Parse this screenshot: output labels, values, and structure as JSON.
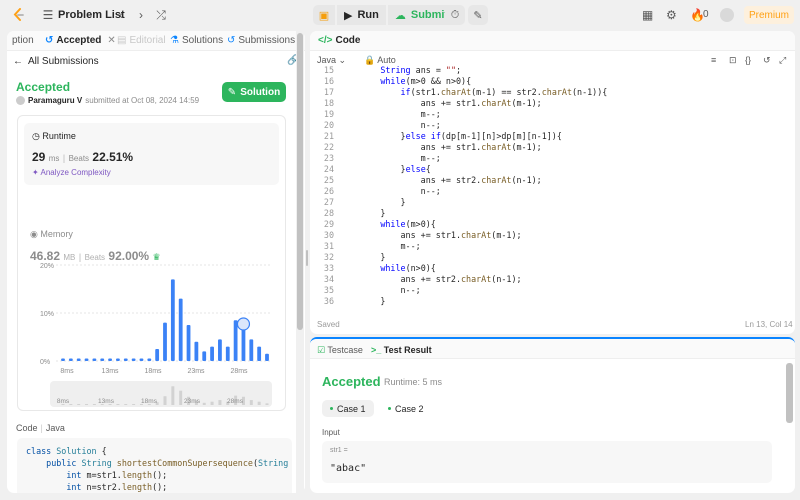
{
  "topbar": {
    "problem_list_label": "Problem List",
    "run_label": "Run",
    "submit_label": "Submit",
    "streak_count": "0",
    "premium_label": "Premium"
  },
  "left_tabs": [
    {
      "label": "ption"
    },
    {
      "label": "Accepted"
    },
    {
      "label": "Editorial"
    },
    {
      "label": "Solutions"
    },
    {
      "label": "Submissions"
    }
  ],
  "submission": {
    "back_label": "All Submissions",
    "status": "Accepted",
    "user": "Paramaguru V",
    "submitted_text": "submitted at Oct 08, 2024 14:59",
    "solution_button": "Solution"
  },
  "runtime": {
    "label": "Runtime",
    "value": "29",
    "unit": "ms",
    "beats_label": "Beats",
    "beats_value": "22.51%",
    "analyze_label": "Analyze Complexity"
  },
  "memory": {
    "label": "Memory",
    "value": "46.82",
    "unit": "MB",
    "beats_label": "Beats",
    "beats_value": "92.00%"
  },
  "chart_data": {
    "type": "bar",
    "y_ticks": [
      "20%",
      "10%",
      "0%"
    ],
    "ylim": [
      0,
      20
    ],
    "x_ticks": [
      "8ms",
      "13ms",
      "18ms",
      "23ms",
      "28ms"
    ],
    "values": [
      0.5,
      0.5,
      0.5,
      0.5,
      0.5,
      0.5,
      0.5,
      0.5,
      0.5,
      0.5,
      0.5,
      0.5,
      2.5,
      8,
      17,
      13,
      7.5,
      4,
      2,
      3,
      4.5,
      3,
      8.5,
      7.5,
      4.5,
      3,
      1.5
    ],
    "highlight_index": 23,
    "mini_x_ticks": [
      "8ms",
      "13ms",
      "18ms",
      "23ms",
      "28ms"
    ]
  },
  "code_section": {
    "label": "Code",
    "language": "Java",
    "lines": [
      "class Solution {",
      "    public String shortestCommonSupersequence(String",
      "        int m=str1.length();",
      "        int n=str2.length();"
    ]
  },
  "editor": {
    "title": "Code",
    "language": "Java",
    "mode": "Auto",
    "start_line": 15,
    "lines": [
      "        String ans = \"\";",
      "        while(m>0 && n>0){",
      "            if(str1.charAt(m-1) == str2.charAt(n-1)){",
      "                ans += str1.charAt(m-1);",
      "                m--;",
      "                n--;",
      "            }else if(dp[m-1][n]>dp[m][n-1]){",
      "                ans += str1.charAt(m-1);",
      "                m--;",
      "            }else{",
      "                ans += str2.charAt(n-1);",
      "                n--;",
      "            }",
      "        }",
      "        while(m>0){",
      "            ans += str1.charAt(m-1);",
      "            m--;",
      "        }",
      "        while(n>0){",
      "            ans += str2.charAt(n-1);",
      "            n--;",
      "        }"
    ],
    "status_left": "Saved",
    "status_right": "Ln 13, Col 14"
  },
  "console": {
    "tabs": [
      {
        "label": "Testcase"
      },
      {
        "label": "Test Result"
      }
    ],
    "result": "Accepted",
    "runtime": "Runtime: 5 ms",
    "cases": [
      "Case 1",
      "Case 2"
    ],
    "input_label": "Input",
    "param_name": "str1 =",
    "param_value": "\"abac\""
  }
}
